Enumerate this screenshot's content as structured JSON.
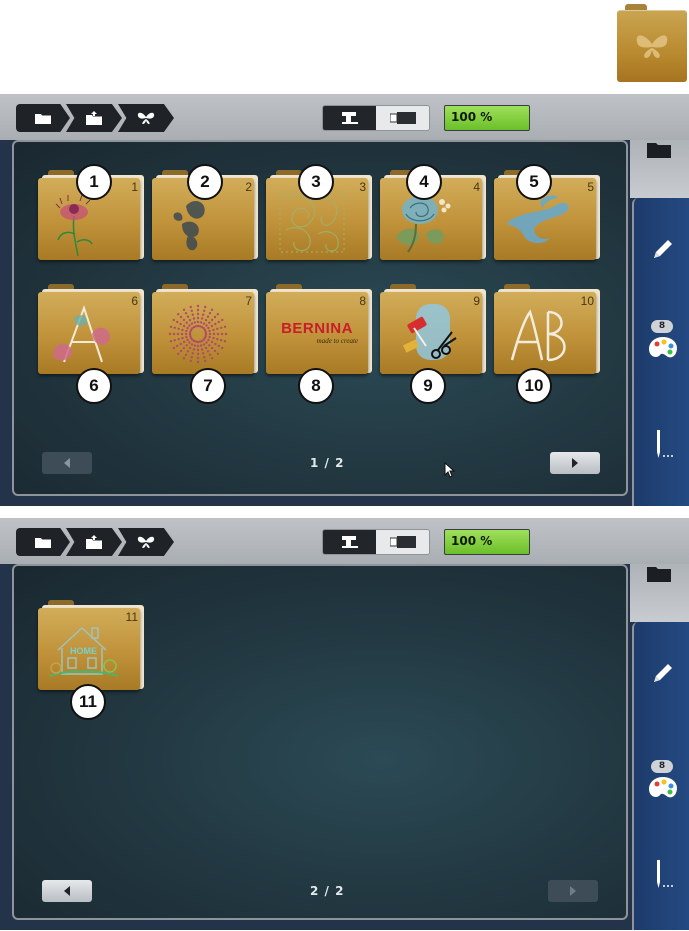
{
  "screens": [
    {
      "zoom": "100 %",
      "page": "1 / 2",
      "palette_badge": "8",
      "folders": [
        {
          "num": "1",
          "callout": "1"
        },
        {
          "num": "2",
          "callout": "2"
        },
        {
          "num": "3",
          "callout": "3"
        },
        {
          "num": "4",
          "callout": "4"
        },
        {
          "num": "5",
          "callout": "5"
        },
        {
          "num": "6",
          "callout": "6"
        },
        {
          "num": "7",
          "callout": "7"
        },
        {
          "num": "8",
          "callout": "8",
          "brand": "BERNINA",
          "tagline": "made to create"
        },
        {
          "num": "9",
          "callout": "9"
        },
        {
          "num": "10",
          "callout": "10"
        }
      ]
    },
    {
      "zoom": "100 %",
      "page": "2 / 2",
      "palette_badge": "8",
      "folders": [
        {
          "num": "11",
          "callout": "11",
          "art_text": "HOME"
        }
      ]
    }
  ],
  "icons": {
    "breadcrumb": [
      "folder-icon",
      "folder-up-icon",
      "butterfly-icon"
    ],
    "mode": [
      "sewing-machine-icon",
      "embroidery-module-icon"
    ],
    "side": [
      "folder-icon",
      "pencil-icon",
      "palette-icon",
      "needle-icon"
    ],
    "nav": [
      "arrow-left-icon",
      "arrow-right-icon"
    ]
  },
  "colors": {
    "zoom_green": "#7ccb35",
    "side_blue": "#244a82",
    "folder_gold": "#c0923a"
  }
}
